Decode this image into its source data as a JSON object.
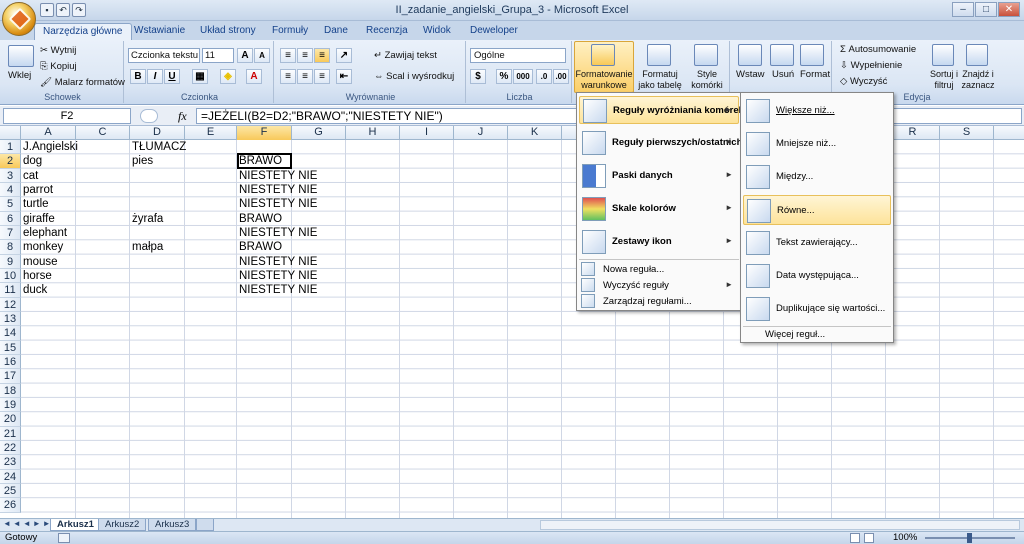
{
  "window": {
    "title": "II_zadanie_angielski_Grupa_3 - Microsoft Excel"
  },
  "tabs": [
    "Narzędzia główne",
    "Wstawianie",
    "Układ strony",
    "Formuły",
    "Dane",
    "Recenzja",
    "Widok",
    "Deweloper"
  ],
  "ribbon": {
    "clipboard": {
      "label": "Schowek",
      "paste": "Wklej",
      "cut": "Wytnij",
      "copy": "Kopiuj",
      "format_painter": "Malarz formatów"
    },
    "font": {
      "label": "Czcionka",
      "font_name": "Czcionka tekstu",
      "font_size": "11",
      "bold": "B",
      "italic": "I",
      "underline": "U"
    },
    "alignment": {
      "label": "Wyrównanie",
      "wrap": "Zawijaj tekst",
      "merge": "Scal i wyśrodkuj"
    },
    "number": {
      "label": "Liczba",
      "format": "Ogólne",
      "percent": "%",
      "thousands": "000"
    },
    "styles": {
      "conditional": "Formatowanie warunkowe",
      "as_table": "Formatuj jako tabelę",
      "cell_styles": "Style komórki"
    },
    "cells": {
      "insert": "Wstaw",
      "delete": "Usuń",
      "format": "Format"
    },
    "editing": {
      "label": "Edycja",
      "autosum": "Autosumowanie",
      "fill": "Wypełnienie",
      "clear": "Wyczyść",
      "sort": "Sortuj i filtruj",
      "find": "Znajdź i zaznacz"
    }
  },
  "formula_bar": {
    "name_box": "F2",
    "fx": "fx",
    "formula": "=JEŻELI(B2=D2;\"BRAWO\";\"NIESTETY NIE\")"
  },
  "columns": [
    "A",
    "C",
    "D",
    "E",
    "F",
    "G",
    "H",
    "I",
    "J",
    "K",
    "L",
    "M",
    "N",
    "O",
    "P",
    "Q",
    "R",
    "S"
  ],
  "rows": [
    "1",
    "2",
    "3",
    "4",
    "5",
    "6",
    "7",
    "8",
    "9",
    "10",
    "11",
    "12",
    "13",
    "14",
    "15",
    "16",
    "17",
    "18",
    "19",
    "20",
    "21",
    "22",
    "23",
    "24",
    "25",
    "26"
  ],
  "cells": {
    "A": [
      "J.Angielski",
      "dog",
      "cat",
      "parrot",
      "turtle",
      "giraffe",
      "elephant",
      "monkey",
      "mouse",
      "horse",
      "duck"
    ],
    "D": [
      "TŁUMACZ",
      "pies",
      "",
      "",
      "",
      "żyrafa",
      "",
      "małpa",
      "",
      "",
      ""
    ],
    "F": [
      "",
      "BRAWO",
      "NIESTETY NIE",
      "NIESTETY NIE",
      "NIESTETY NIE",
      "BRAWO",
      "NIESTETY NIE",
      "BRAWO",
      "NIESTETY NIE",
      "NIESTETY NIE",
      "NIESTETY NIE"
    ]
  },
  "sheets": [
    "Arkusz1",
    "Arkusz2",
    "Arkusz3"
  ],
  "status": {
    "ready": "Gotowy",
    "zoom": "100%"
  },
  "menu1": {
    "items": [
      "Reguły wyróżniania komórek",
      "Reguły pierwszych/ostatnich",
      "Paski danych",
      "Skale kolorów",
      "Zestawy ikon"
    ],
    "small_items": [
      "Nowa reguła...",
      "Wyczyść reguły",
      "Zarządzaj regułami..."
    ]
  },
  "menu2": {
    "items": [
      "Większe niż...",
      "Mniejsze niż...",
      "Między...",
      "Równe...",
      "Tekst zawierający...",
      "Data występująca...",
      "Duplikujące się wartości..."
    ],
    "more": "Więcej reguł..."
  }
}
